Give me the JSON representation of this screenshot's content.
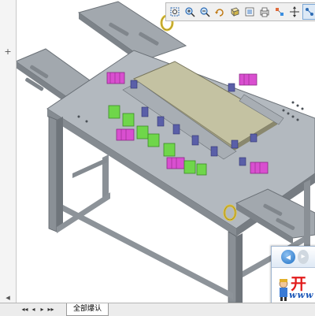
{
  "toolbar": {
    "buttons": [
      {
        "name": "zoom-area-icon"
      },
      {
        "name": "zoom-in-icon"
      },
      {
        "name": "zoom-out-icon"
      },
      {
        "name": "rotate-view-icon"
      },
      {
        "name": "view-orientation-icon"
      },
      {
        "name": "display-style-icon"
      },
      {
        "name": "print-icon"
      },
      {
        "name": "explode-icon"
      },
      {
        "name": "pan-icon"
      },
      {
        "name": "section-view-icon"
      }
    ]
  },
  "left_panel": {
    "add_label": "+",
    "collapse_label": "◂"
  },
  "statusbar": {
    "first_label": "◂◂",
    "prev_label": "◂",
    "next_label": "▸",
    "last_label": "▸▸",
    "sheet_tab": "全部爆认"
  },
  "popup": {
    "back_label": "◂",
    "fwd_label": "▸",
    "logo_text": "开",
    "logo_sub": "www"
  },
  "colors": {
    "frame": "#9aa0a6",
    "frame_dark": "#6b7177",
    "plate": "#b9c0c6",
    "top_plate": "#c9c7a8",
    "cylinder_magenta": "#d94fd0",
    "block_green": "#6fd64a",
    "clamp_blue": "#5a5fa8",
    "ring_yellow": "#e0c43a"
  }
}
